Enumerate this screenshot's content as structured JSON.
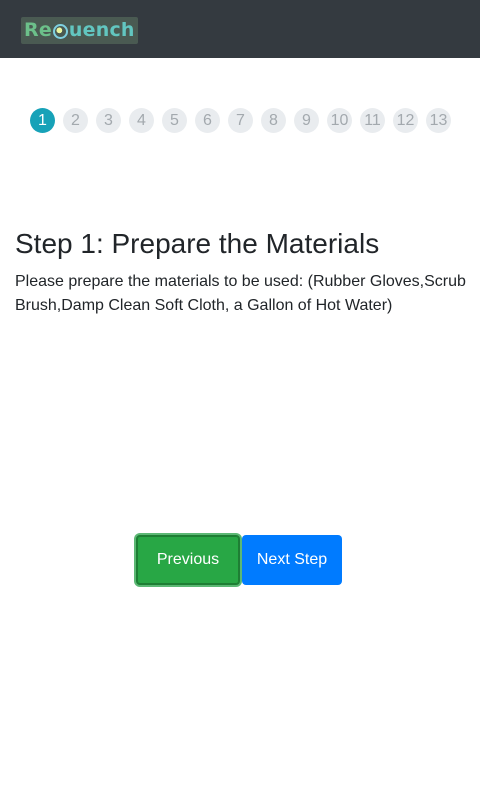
{
  "header": {
    "logo_text": "ReQuench"
  },
  "steps": [
    "1",
    "2",
    "3",
    "4",
    "5",
    "6",
    "7",
    "8",
    "9",
    "10",
    "11",
    "12",
    "13"
  ],
  "active_step": "1",
  "content": {
    "title": "Step 1: Prepare the Materials",
    "description": "Please prepare the materials to be used: (Rubber Gloves,Scrub Brush,Damp Clean Soft Cloth, a Gallon of Hot Water)"
  },
  "buttons": {
    "previous_label": "Previous",
    "next_label": "Next Step"
  },
  "colors": {
    "navbar": "#343a40",
    "active_step": "#17a2b8",
    "previous_button": "#28a745",
    "next_button": "#007bff"
  }
}
